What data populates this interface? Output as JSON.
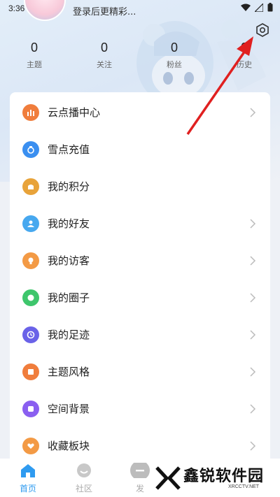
{
  "status_bar": {
    "time": "3:36"
  },
  "profile": {
    "login_prompt": "登录后更精彩..."
  },
  "stats": [
    {
      "value": "0",
      "label": "主题"
    },
    {
      "value": "0",
      "label": "关注"
    },
    {
      "value": "0",
      "label": "粉丝"
    },
    {
      "value": "0",
      "label": "历史"
    }
  ],
  "menu": [
    {
      "label": "云点播中心",
      "icon": "chart-bars-icon",
      "color": "#f07d3c",
      "chevron": true
    },
    {
      "label": "雪点充值",
      "icon": "diamond-icon",
      "color": "#3a8ff0",
      "chevron": false
    },
    {
      "label": "我的积分",
      "icon": "bag-icon",
      "color": "#e8a33a",
      "chevron": false
    },
    {
      "label": "我的好友",
      "icon": "person-icon",
      "color": "#47a8ef",
      "chevron": true
    },
    {
      "label": "我的访客",
      "icon": "bulb-icon",
      "color": "#f39a45",
      "chevron": true
    },
    {
      "label": "我的圈子",
      "icon": "chat-icon",
      "color": "#3ec66c",
      "chevron": true
    },
    {
      "label": "我的足迹",
      "icon": "clock-icon",
      "color": "#6a62e8",
      "chevron": true
    },
    {
      "label": "主题风格",
      "icon": "card-icon",
      "color": "#f07d3c",
      "chevron": true
    },
    {
      "label": "空间背景",
      "icon": "square-icon",
      "color": "#8a5ff0",
      "chevron": true
    },
    {
      "label": "收藏板块",
      "icon": "heart-icon",
      "color": "#f39a45",
      "chevron": true
    }
  ],
  "bottom_nav": [
    {
      "label": "首页",
      "active": true
    },
    {
      "label": "社区",
      "active": false
    },
    {
      "label": "发",
      "active": false
    }
  ],
  "watermark": {
    "text": "鑫锐软件园",
    "sub": "XRCCTV.NET"
  },
  "colors": {
    "accent": "#2f9bf0",
    "arrow": "#e02020"
  }
}
